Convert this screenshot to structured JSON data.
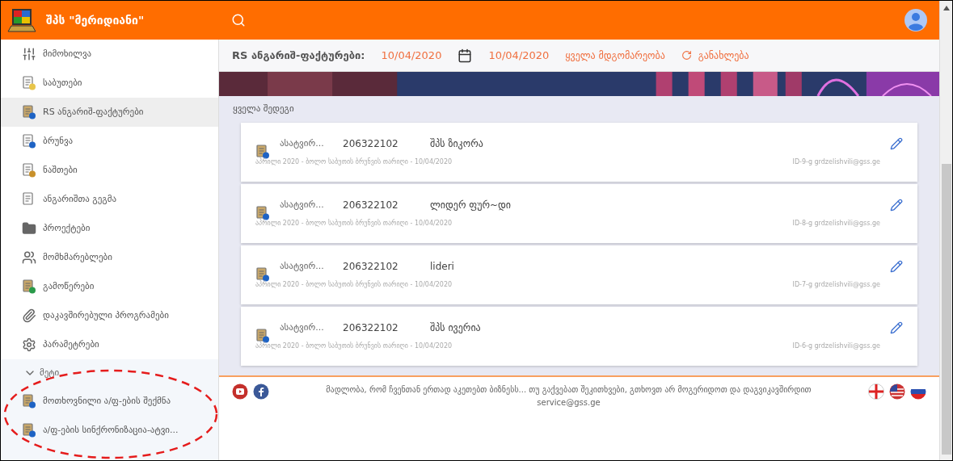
{
  "header": {
    "title": "შპს \"მერიდიანი\""
  },
  "sidebar": {
    "items": [
      {
        "label": "მიმოხილვა",
        "selected": false
      },
      {
        "label": "საბუთები",
        "selected": false
      },
      {
        "label": "RS ანგარიშ-ფაქტურები",
        "selected": true
      },
      {
        "label": "ბრუნვა",
        "selected": false
      },
      {
        "label": "ნაშთები",
        "selected": false
      },
      {
        "label": "ანგარიშთა გეგმა",
        "selected": false
      },
      {
        "label": "პროექტები",
        "selected": false
      },
      {
        "label": "მომხმარებლები",
        "selected": false
      },
      {
        "label": "გამოწერები",
        "selected": false
      },
      {
        "label": "დაკავშირებული პროგრამები",
        "selected": false
      },
      {
        "label": "პარამეტრები",
        "selected": false
      }
    ],
    "more": {
      "label": "მეტი",
      "expanded": true,
      "children": [
        {
          "label": "მოთხოვნილი ა/ფ-ების შექმნა"
        },
        {
          "label": "ა/ფ-ების სინქრონიზაცია-ატვი..."
        }
      ]
    }
  },
  "toolbar": {
    "title": "RS ანგარიშ-ფაქტურები:",
    "date_from": "10/04/2020",
    "date_to": "10/04/2020",
    "status_filter": "ყველა მდგომარეობა",
    "refresh": "განახლება"
  },
  "results": {
    "heading": "ყველა შედეგი",
    "rows": [
      {
        "status": "ასატვირ...",
        "code": "206322102",
        "name": "შპს ზიკორა",
        "details": "აპრილი 2020 - ბოლო საბუთის ბრუნვის თარიღი - 10/04/2020",
        "user": "ID-9-g grdzelishvili@gss.ge"
      },
      {
        "status": "ასატვირ...",
        "code": "206322102",
        "name": "ლიდერ ფურ~დი",
        "details": "აპრილი 2020 - ბოლო საბუთის ბრუნვის თარიღი - 10/04/2020",
        "user": "ID-8-g grdzelishvili@gss.ge"
      },
      {
        "status": "ასატვირ...",
        "code": "206322102",
        "name": "lideri",
        "details": "აპრილი 2020 - ბოლო საბუთის ბრუნვის თარიღი - 10/04/2020",
        "user": "ID-7-g grdzelishvili@gss.ge"
      },
      {
        "status": "ასატვირ...",
        "code": "206322102",
        "name": "შპს ივერია",
        "details": "აპრილი 2020 - ბოლო საბუთის ბრუნვის თარიღი - 10/04/2020",
        "user": "ID-6-g grdzelishvili@gss.ge"
      }
    ]
  },
  "footer": {
    "message": "მადლობა, რომ ჩვენთან ერთად აკეთებთ ბიზნესს... თუ გაქვებათ შეკითხვები, გთხოვთ არ მოგერიდოთ და დაგვიკავშირდით service@gss.ge"
  }
}
